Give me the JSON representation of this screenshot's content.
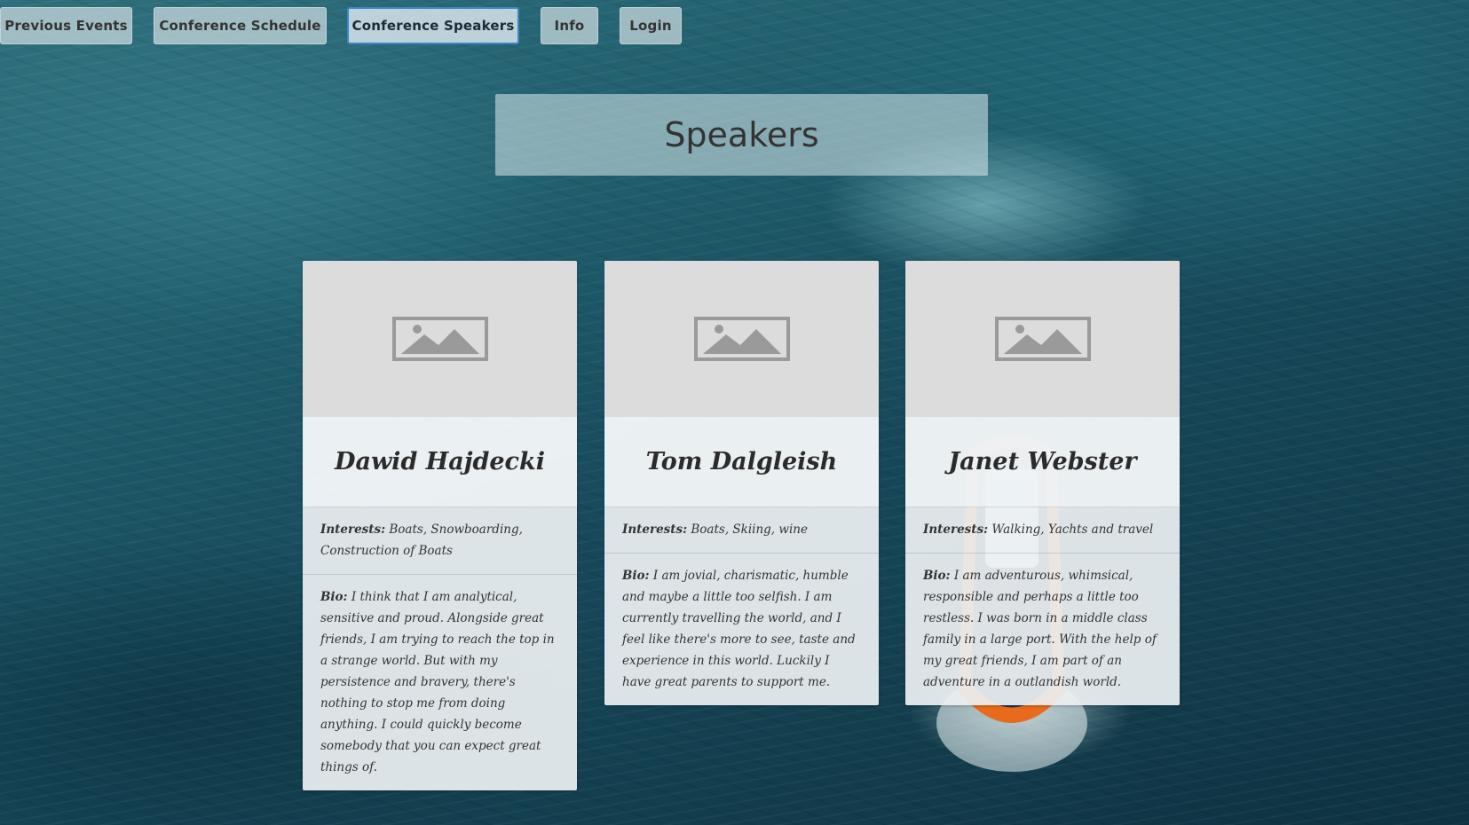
{
  "nav": {
    "items": [
      {
        "label": "Previous Events",
        "active": false
      },
      {
        "label": "Conference Schedule",
        "active": false
      },
      {
        "label": "Conference Speakers",
        "active": true
      },
      {
        "label": "Info",
        "active": false
      },
      {
        "label": "Login",
        "active": false
      }
    ]
  },
  "page": {
    "title": "Speakers"
  },
  "speakers": [
    {
      "name": "Dawid Hajdecki",
      "interests_label": "Interests:",
      "interests": "Boats, Snowboarding, Construction of Boats",
      "bio_label": "Bio:",
      "bio": "I think that I am analytical, sensitive and proud. Alongside great friends, I am trying to reach the top in a strange world. But with my persistence and bravery, there's nothing to stop me from doing anything. I could quickly become somebody that you can expect great things of."
    },
    {
      "name": "Tom Dalgleish",
      "interests_label": "Interests:",
      "interests": "Boats, Skiing, wine",
      "bio_label": "Bio:",
      "bio": "I am jovial, charismatic, humble and maybe a little too selfish. I am currently travelling the world, and I feel like there's more to see, taste and experience in this world. Luckily I have great parents to support me."
    },
    {
      "name": "Janet Webster",
      "interests_label": "Interests:",
      "interests": "Walking, Yachts and travel",
      "bio_label": "Bio:",
      "bio": "I am adventurous, whimsical, responsible and perhaps a little too restless. I was born in a middle class family in a large port. With the help of my great friends, I am part of an adventure in a outlandish world."
    }
  ],
  "icons": {
    "card_image": "image-placeholder-icon"
  },
  "colors": {
    "active_nav_border": "#3d86c7",
    "placeholder_bg": "#dcdcdc",
    "placeholder_icon": "#9a9a9a"
  }
}
